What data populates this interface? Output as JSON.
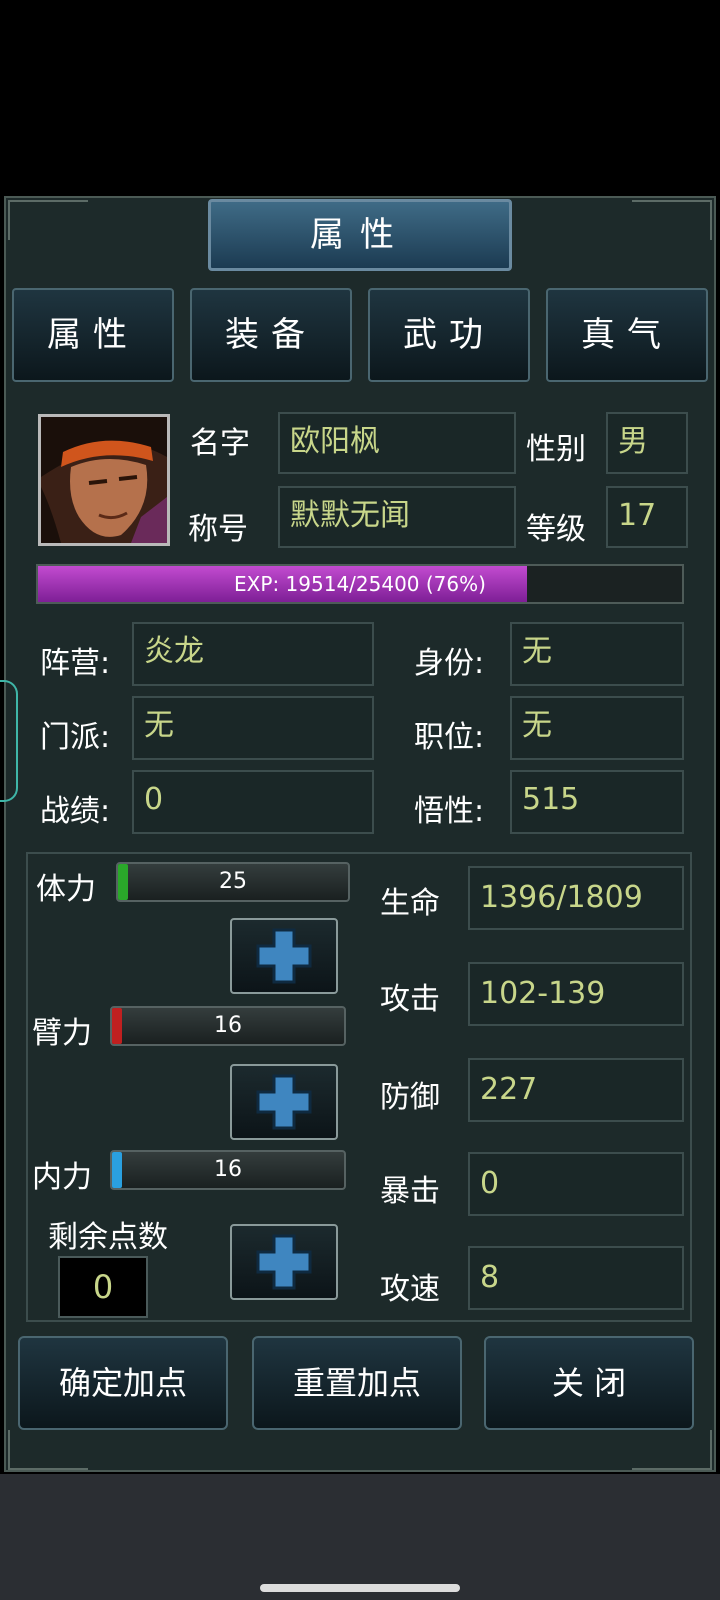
{
  "title": "属性",
  "tabs": [
    "属性",
    "装备",
    "武功",
    "真气"
  ],
  "profile": {
    "name_label": "名字",
    "name": "欧阳枫",
    "gender_label": "性别",
    "gender": "男",
    "title_label": "称号",
    "title": "默默无闻",
    "level_label": "等级",
    "level": "17"
  },
  "exp": {
    "text": "EXP:  19514/25400  (76%)",
    "percent": 76
  },
  "info": [
    {
      "label": "阵营:",
      "value": "炎龙"
    },
    {
      "label": "身份:",
      "value": "无"
    },
    {
      "label": "门派:",
      "value": "无"
    },
    {
      "label": "职位:",
      "value": "无"
    },
    {
      "label": "战绩:",
      "value": "0"
    },
    {
      "label": "悟性:",
      "value": "515"
    }
  ],
  "attributes": [
    {
      "label": "体力",
      "value": "25",
      "color": "#2aa82a"
    },
    {
      "label": "臂力",
      "value": "16",
      "color": "#c02020"
    },
    {
      "label": "内力",
      "value": "16",
      "color": "#2aa0e0"
    }
  ],
  "remaining": {
    "label": "剩余点数",
    "value": "0"
  },
  "stats": [
    {
      "label": "生命",
      "value": "1396/1809"
    },
    {
      "label": "攻击",
      "value": "102-139"
    },
    {
      "label": "防御",
      "value": "227"
    },
    {
      "label": "暴击",
      "value": "0"
    },
    {
      "label": "攻速",
      "value": "8"
    }
  ],
  "buttons": {
    "confirm": "确定加点",
    "reset": "重置加点",
    "close": "关 闭"
  },
  "colors": {
    "panel": "#1d2a2a",
    "value_text": "#c8d68a",
    "exp_fill": "#9b32b4"
  }
}
